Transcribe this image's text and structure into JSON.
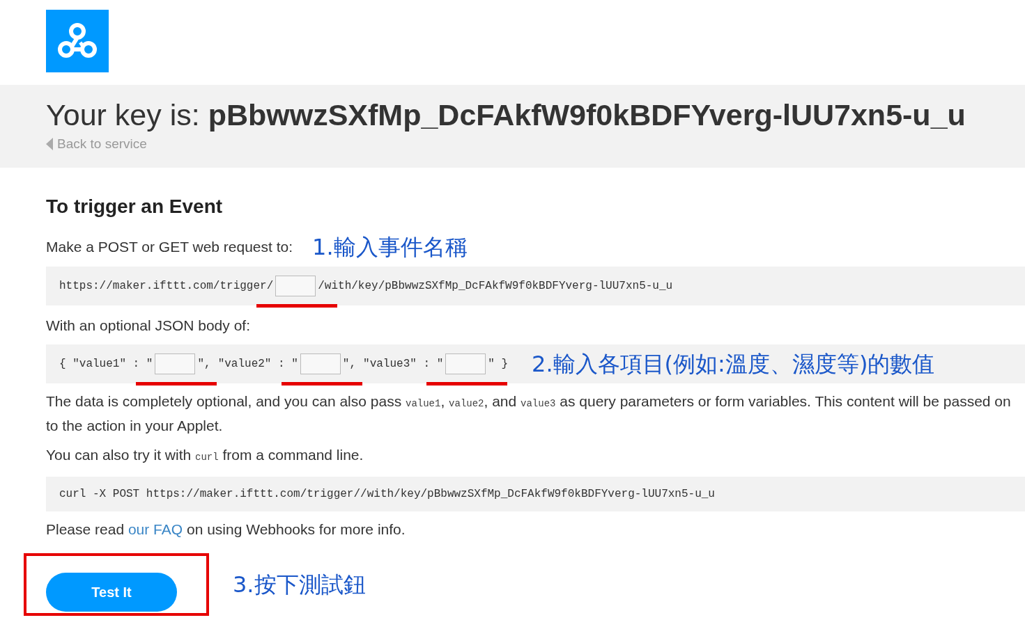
{
  "header": {
    "key_label": "Your key is:",
    "key": "pBbwwzSXfMp_DcFAkfW9f0kBDFYverg-lUU7xn5-u_u",
    "back_link": "Back to service"
  },
  "section": {
    "title": "To trigger an Event",
    "request_label": "Make a POST or GET web request to:",
    "request_note": "1.輸入事件名稱",
    "url": {
      "prefix": "https://maker.ifttt.com/trigger/",
      "suffix": "/with/key/pBbwwzSXfMp_DcFAkfW9f0kBDFYverg-lUU7xn5-u_u"
    },
    "body_label": "With an optional JSON body of:",
    "body_fields": [
      {
        "key": "{ \"value1\" : \"",
        "after": "\","
      },
      {
        "key": "\"value2\" : \"",
        "after": "\","
      },
      {
        "key": "\"value3\" : \"",
        "after": "\" }"
      }
    ],
    "body_note": "2.輸入各項目(例如:溫度、濕度等)的數值",
    "paragraphs": [
      [
        {
          "kind": "text",
          "text": "The data is completely optional, and you can also pass "
        },
        {
          "kind": "code",
          "text": "value1"
        },
        {
          "kind": "text",
          "text": ", "
        },
        {
          "kind": "code",
          "text": "value2"
        },
        {
          "kind": "text",
          "text": ", and "
        },
        {
          "kind": "code",
          "text": "value3"
        },
        {
          "kind": "text",
          "text": " as query parameters or form variables. This content will be passed on to the action in your Applet."
        }
      ],
      [
        {
          "kind": "text",
          "text": "You can also try it with "
        },
        {
          "kind": "code",
          "text": "curl"
        },
        {
          "kind": "text",
          "text": " from a command line."
        }
      ]
    ],
    "curl": "curl -X POST https://maker.ifttt.com/trigger//with/key/pBbwwzSXfMp_DcFAkfW9f0kBDFYverg-lUU7xn5-u_u",
    "faq": [
      {
        "kind": "text",
        "text": "Please read "
      },
      {
        "kind": "link",
        "text": "our FAQ"
      },
      {
        "kind": "text",
        "text": " on using Webhooks for more info."
      }
    ],
    "button": "Test It",
    "button_note": "3.按下測試鈕"
  }
}
